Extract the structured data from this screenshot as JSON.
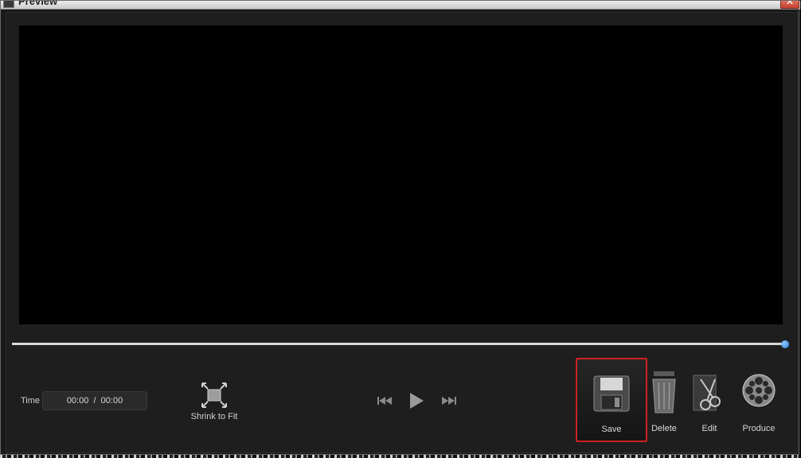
{
  "window": {
    "title": "Preview",
    "close_label": "X"
  },
  "time": {
    "label": "Time",
    "current": "00:00",
    "separator": "/",
    "total": "00:00"
  },
  "playback": {
    "progress": 1.0
  },
  "toolbar": {
    "shrink_label": "Shrink to Fit",
    "save_label": "Save",
    "delete_label": "Delete",
    "edit_label": "Edit",
    "produce_label": "Produce"
  },
  "icons": {
    "shrink": "shrink-to-fit-icon",
    "previous": "skip-back-icon",
    "play": "play-icon",
    "next": "skip-forward-icon",
    "save": "floppy-disk-icon",
    "delete": "trash-can-icon",
    "edit": "scissors-film-icon",
    "produce": "film-reel-icon"
  },
  "colors": {
    "accent": "#2b7fd6",
    "highlight": "#cc2222",
    "background": "#1e1e1e",
    "video": "#000000"
  }
}
